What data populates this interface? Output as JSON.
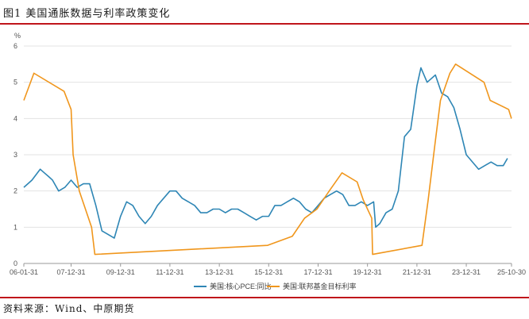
{
  "figure": {
    "title": "图1 美国通胀数据与利率政策变化",
    "source": "资料来源：Wind、中原期货"
  },
  "colors": {
    "rule": "#c0151b",
    "pce": "#2e86b5",
    "rate": "#f0961c"
  },
  "chart_data": {
    "type": "line",
    "ylabel": "%",
    "ylim": [
      0,
      6
    ],
    "yticks": [
      0,
      1,
      2,
      3,
      4,
      5,
      6
    ],
    "xlim": [
      "2006-01-31",
      "2025-10-30"
    ],
    "xticks": [
      {
        "date": "2006-01-31",
        "label": "06-01-31"
      },
      {
        "date": "2007-12-31",
        "label": "07-12-31"
      },
      {
        "date": "2009-12-31",
        "label": "09-12-31"
      },
      {
        "date": "2011-12-31",
        "label": "11-12-31"
      },
      {
        "date": "2013-12-31",
        "label": "13-12-31"
      },
      {
        "date": "2015-12-31",
        "label": "15-12-31"
      },
      {
        "date": "2017-12-31",
        "label": "17-12-31"
      },
      {
        "date": "2019-12-31",
        "label": "19-12-31"
      },
      {
        "date": "2021-12-31",
        "label": "21-12-31"
      },
      {
        "date": "2023-12-31",
        "label": "23-12-31"
      },
      {
        "date": "2025-10-30",
        "label": "25-10-30"
      }
    ],
    "grid": "horizontal",
    "legend_position": "bottom",
    "series": [
      {
        "name": "美国:核心PCE:同比",
        "color": "#2e86b5",
        "points": [
          [
            "2006-01-31",
            2.1
          ],
          [
            "2006-05-31",
            2.3
          ],
          [
            "2006-09-30",
            2.6
          ],
          [
            "2006-11-30",
            2.5
          ],
          [
            "2007-01-31",
            2.4
          ],
          [
            "2007-03-31",
            2.3
          ],
          [
            "2007-06-30",
            2.0
          ],
          [
            "2007-09-30",
            2.1
          ],
          [
            "2007-12-31",
            2.3
          ],
          [
            "2008-03-31",
            2.1
          ],
          [
            "2008-06-30",
            2.2
          ],
          [
            "2008-09-30",
            2.2
          ],
          [
            "2008-12-31",
            1.6
          ],
          [
            "2009-03-31",
            0.9
          ],
          [
            "2009-06-30",
            0.8
          ],
          [
            "2009-09-30",
            0.7
          ],
          [
            "2009-12-31",
            1.3
          ],
          [
            "2010-03-31",
            1.7
          ],
          [
            "2010-06-30",
            1.6
          ],
          [
            "2010-09-30",
            1.3
          ],
          [
            "2010-12-31",
            1.1
          ],
          [
            "2011-03-31",
            1.3
          ],
          [
            "2011-06-30",
            1.6
          ],
          [
            "2011-09-30",
            1.8
          ],
          [
            "2011-12-31",
            2.0
          ],
          [
            "2012-03-31",
            2.0
          ],
          [
            "2012-06-30",
            1.8
          ],
          [
            "2012-09-30",
            1.7
          ],
          [
            "2012-12-31",
            1.6
          ],
          [
            "2013-03-31",
            1.4
          ],
          [
            "2013-06-30",
            1.4
          ],
          [
            "2013-09-30",
            1.5
          ],
          [
            "2013-12-31",
            1.5
          ],
          [
            "2014-03-31",
            1.4
          ],
          [
            "2014-06-30",
            1.5
          ],
          [
            "2014-09-30",
            1.5
          ],
          [
            "2014-12-31",
            1.4
          ],
          [
            "2015-03-31",
            1.3
          ],
          [
            "2015-06-30",
            1.2
          ],
          [
            "2015-09-30",
            1.3
          ],
          [
            "2015-12-31",
            1.3
          ],
          [
            "2016-03-31",
            1.6
          ],
          [
            "2016-06-30",
            1.6
          ],
          [
            "2016-09-30",
            1.7
          ],
          [
            "2016-12-31",
            1.8
          ],
          [
            "2017-03-31",
            1.7
          ],
          [
            "2017-06-30",
            1.5
          ],
          [
            "2017-09-30",
            1.4
          ],
          [
            "2017-12-31",
            1.6
          ],
          [
            "2018-03-31",
            1.8
          ],
          [
            "2018-06-30",
            1.9
          ],
          [
            "2018-09-30",
            2.0
          ],
          [
            "2018-12-31",
            1.9
          ],
          [
            "2019-03-31",
            1.6
          ],
          [
            "2019-06-30",
            1.6
          ],
          [
            "2019-09-30",
            1.7
          ],
          [
            "2019-12-31",
            1.6
          ],
          [
            "2020-03-31",
            1.7
          ],
          [
            "2020-04-30",
            1.0
          ],
          [
            "2020-06-30",
            1.1
          ],
          [
            "2020-09-30",
            1.4
          ],
          [
            "2020-12-31",
            1.5
          ],
          [
            "2021-03-31",
            2.0
          ],
          [
            "2021-06-30",
            3.5
          ],
          [
            "2021-09-30",
            3.7
          ],
          [
            "2021-12-31",
            4.9
          ],
          [
            "2022-02-28",
            5.4
          ],
          [
            "2022-05-31",
            5.0
          ],
          [
            "2022-09-30",
            5.2
          ],
          [
            "2022-12-31",
            4.7
          ],
          [
            "2023-03-31",
            4.6
          ],
          [
            "2023-06-30",
            4.3
          ],
          [
            "2023-09-30",
            3.7
          ],
          [
            "2023-12-31",
            3.0
          ],
          [
            "2024-03-31",
            2.8
          ],
          [
            "2024-06-30",
            2.6
          ],
          [
            "2024-09-30",
            2.7
          ],
          [
            "2024-12-31",
            2.8
          ],
          [
            "2025-03-31",
            2.7
          ],
          [
            "2025-06-30",
            2.7
          ],
          [
            "2025-08-31",
            2.9
          ]
        ]
      },
      {
        "name": "美国:联邦基金目标利率",
        "color": "#f0961c",
        "points": [
          [
            "2006-01-31",
            4.5
          ],
          [
            "2006-06-29",
            5.25
          ],
          [
            "2007-09-18",
            4.75
          ],
          [
            "2007-12-31",
            4.25
          ],
          [
            "2008-01-30",
            3.0
          ],
          [
            "2008-04-30",
            2.0
          ],
          [
            "2008-10-29",
            1.0
          ],
          [
            "2008-12-16",
            0.25
          ],
          [
            "2015-12-16",
            0.5
          ],
          [
            "2016-12-14",
            0.75
          ],
          [
            "2017-06-14",
            1.25
          ],
          [
            "2017-12-13",
            1.5
          ],
          [
            "2018-06-13",
            2.0
          ],
          [
            "2018-12-19",
            2.5
          ],
          [
            "2019-07-31",
            2.25
          ],
          [
            "2019-10-30",
            1.75
          ],
          [
            "2020-03-03",
            1.25
          ],
          [
            "2020-03-15",
            0.25
          ],
          [
            "2022-03-16",
            0.5
          ],
          [
            "2022-06-15",
            1.75
          ],
          [
            "2022-09-21",
            3.25
          ],
          [
            "2022-12-14",
            4.5
          ],
          [
            "2023-05-03",
            5.25
          ],
          [
            "2023-07-26",
            5.5
          ],
          [
            "2024-09-18",
            5.0
          ],
          [
            "2024-12-18",
            4.5
          ],
          [
            "2025-09-17",
            4.25
          ],
          [
            "2025-10-29",
            4.0
          ]
        ]
      }
    ]
  }
}
